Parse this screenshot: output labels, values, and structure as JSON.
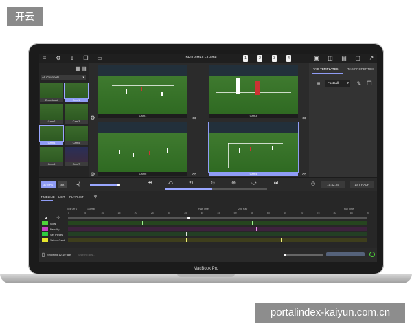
{
  "corner_badge": "开云",
  "watermark": "portalindex-kaiyun.com.cn",
  "laptop_label": "MacBook Pro",
  "app": {
    "title": "BRU v MEC - Game",
    "tag_chips": [
      "1",
      "2",
      "3",
      "4"
    ]
  },
  "sidebar": {
    "channel_select": "All Channels",
    "cameras": [
      {
        "label": "Broadcast",
        "selected": false
      },
      {
        "label": "Cam1",
        "selected": true
      },
      {
        "label": "Cam2",
        "selected": false
      },
      {
        "label": "Cam3",
        "selected": false
      },
      {
        "label": "Cam4",
        "selected": true
      },
      {
        "label": "Cam5",
        "selected": false
      },
      {
        "label": "Cam6",
        "selected": false
      },
      {
        "label": "Cam7",
        "selected": false
      }
    ]
  },
  "videos": [
    {
      "label": "Cam1",
      "selected": false
    },
    {
      "label": "Cam3",
      "selected": false
    },
    {
      "label": "Cam6",
      "selected": false
    },
    {
      "label": "Cam4",
      "selected": true
    }
  ],
  "right_panel": {
    "tabs": [
      "TAG TEMPLATES",
      "TAG PROPERTIES"
    ],
    "template_select": "Football"
  },
  "controls": {
    "buttons": [
      "30 MPS",
      "8X"
    ],
    "time": "10:42:25",
    "half_button": "1ST HALF"
  },
  "timeline": {
    "tabs": [
      "TIMELINE",
      "LIST",
      "PLAYLIST"
    ],
    "markers": [
      "Kick Off 1",
      "1st Half",
      "Half Time",
      "2nd Half",
      "Full Time"
    ],
    "ticks": [
      "0",
      "5",
      "10",
      "15",
      "20",
      "25",
      "30",
      "35",
      "40",
      "45",
      "50",
      "55",
      "60",
      "65",
      "70",
      "75",
      "80",
      "85",
      "90"
    ],
    "tracks": [
      {
        "name": "Goal",
        "color": "#4ed33a"
      },
      {
        "name": "Penalty",
        "color": "#c640c6"
      },
      {
        "name": "Set Pieces",
        "color": "#2ecc40"
      },
      {
        "name": "Yellow Card",
        "color": "#e6e62d"
      }
    ],
    "status": "Showing 12/10 tags",
    "search_placeholder": "Search Tags..."
  }
}
